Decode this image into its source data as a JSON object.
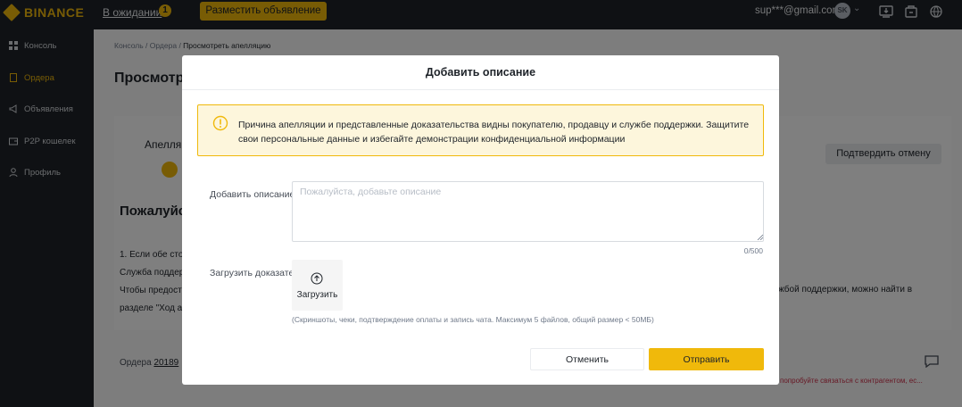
{
  "header": {
    "logo_text": "BINANCE",
    "waiting_label": "В ожидании",
    "waiting_count": "1",
    "post_ad_label": "Разместить объявление",
    "email": "sup***@gmail.com",
    "avatar_initials": "SK",
    "accent_color": "#f0b90b"
  },
  "sidebar": {
    "items": [
      {
        "label": "Консоль",
        "icon": "grid-icon"
      },
      {
        "label": "Ордера",
        "icon": "document-icon"
      },
      {
        "label": "Объявления",
        "icon": "megaphone-icon"
      },
      {
        "label": "P2P кошелек",
        "icon": "wallet-icon"
      },
      {
        "label": "Профиль",
        "icon": "user-icon"
      }
    ]
  },
  "breadcrumb": {
    "items": [
      "Консоль",
      "Ордера"
    ],
    "current": "Просмотреть апелляцию"
  },
  "background": {
    "title": "Просмотре",
    "appeal_label": "Апелляц",
    "confirm_cancel_label": "Подтвердить отмену",
    "please_heading": "Пожалуйст",
    "line1": "1. Если обе сто",
    "line2": "Служба поддер",
    "line3": "Чтобы предост",
    "line4": "разделе \"Ход а",
    "line3_tail": "жбой поддержки, можно найти в",
    "orders_label": "Ордера",
    "order_number": "20189",
    "contact_text": "попробуйте связаться с контрагентом, ес..."
  },
  "modal": {
    "title": "Добавить описание",
    "warning_text": "Причина апелляции и представленные доказательства видны покупателю, продавцу и службе поддержки. Защитите свои персональные данные и избегайте демонстрации конфиденциальной информации",
    "description_label": "Добавить описание",
    "description_placeholder": "Пожалуйста, добавьте описание",
    "description_value": "",
    "char_counter": "0/500",
    "upload_label": "Загрузить доказате",
    "upload_button_label": "Загрузить",
    "upload_hint": "(Скриншоты, чеки, подтверждение оплаты и запись чата. Максимум 5 файлов, общий размер < 50МБ)",
    "cancel_label": "Отменить",
    "submit_label": "Отправить"
  }
}
